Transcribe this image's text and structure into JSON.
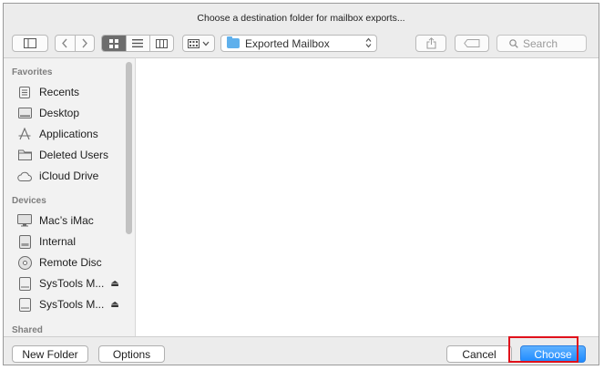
{
  "dialog": {
    "title": "Choose a destination folder for mailbox exports..."
  },
  "toolbar": {
    "path": "Exported Mailbox",
    "search_placeholder": "Search"
  },
  "sidebar": {
    "favorites_heading": "Favorites",
    "favorites": [
      {
        "label": "Recents",
        "icon": "recents-icon"
      },
      {
        "label": "Desktop",
        "icon": "desktop-icon"
      },
      {
        "label": "Applications",
        "icon": "applications-icon"
      },
      {
        "label": "Deleted Users",
        "icon": "folder-icon"
      },
      {
        "label": "iCloud Drive",
        "icon": "cloud-icon"
      }
    ],
    "devices_heading": "Devices",
    "devices": [
      {
        "label": "Mac’s iMac",
        "icon": "imac-icon"
      },
      {
        "label": "Internal",
        "icon": "internal-disk-icon"
      },
      {
        "label": "Remote Disc",
        "icon": "disc-icon"
      },
      {
        "label": "SysTools M...",
        "icon": "external-disk-icon",
        "eject": "⏏"
      },
      {
        "label": "SysTools M...",
        "icon": "external-disk-icon",
        "eject": "⏏"
      }
    ],
    "shared_heading": "Shared"
  },
  "buttons": {
    "new_folder": "New Folder",
    "options": "Options",
    "cancel": "Cancel",
    "choose": "Choose"
  },
  "colors": {
    "accent": "#1e8aff",
    "highlight": "#e0111b",
    "folder": "#5fb0ec"
  }
}
